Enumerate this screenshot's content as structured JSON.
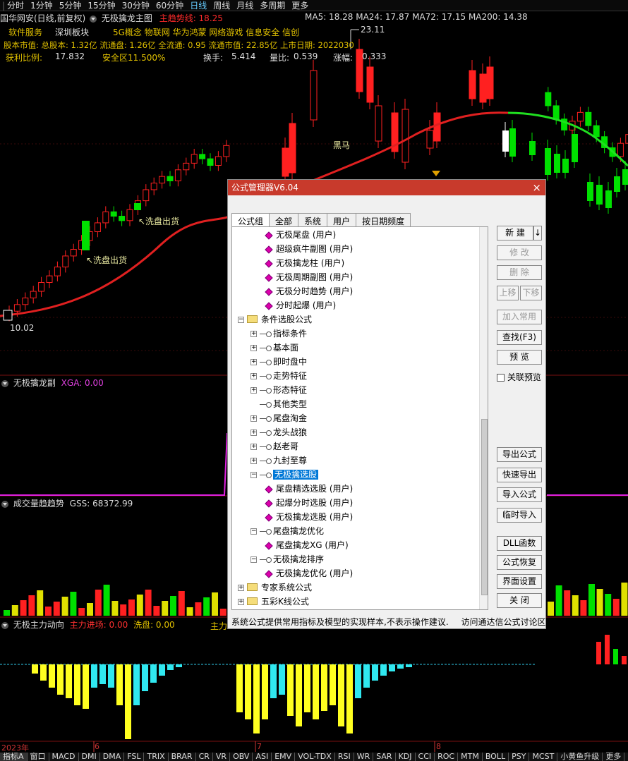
{
  "topbar": {
    "items": [
      "分时",
      "1分钟",
      "5分钟",
      "15分钟",
      "30分钟",
      "60分钟",
      "日线",
      "周线",
      "月线",
      "多周期",
      "更多"
    ],
    "active": "日线"
  },
  "main_panel": {
    "stock": "国华网安(日线,前复权)",
    "indicator_name": "无极擒龙主图",
    "trend_label": "主趋势线: 18.25",
    "ma": "MA5: 18.28  MA24: 17.87  MA72: 17.15  MA200: 14.38",
    "tags": [
      "软件服务",
      "深圳板块",
      "5G概念 物联网 华为鸿蒙 网络游戏 信息安全 信创"
    ],
    "info_line": "股本市值: 总股本: 1.32亿 流通盘: 1.26亿 全流通: 0.95 流通市值: 22.85亿 上市日期: 2022030",
    "stats": {
      "profit_label": "获利比例:",
      "profit_value": "17.832",
      "safety": "安全区11.500%",
      "turnover_label": "换手:",
      "turnover_value": "5.414",
      "vol_ratio_label": "量比:",
      "vol_ratio_value": "0.539",
      "change_label": "涨幅:",
      "change_value": "0.333"
    },
    "annotations": {
      "high": "23.11",
      "low": "10.02",
      "wash1": "↖洗盘出货",
      "wash2": "↖洗盘出货",
      "black_horse": "黑马"
    }
  },
  "sub1": {
    "name": "无极擒龙副",
    "value": "XGA: 0.00"
  },
  "sub2": {
    "name": "成交量趋趋势",
    "value": "GSS: 68372.99"
  },
  "sub3": {
    "name": "无极主力动向",
    "v1": "主力进场: 0.00",
    "v2": "洗盘: 0.00",
    "cut": "主力"
  },
  "date_axis": [
    "2023年",
    "6",
    "7",
    "8"
  ],
  "bottom_tabs": [
    "指标A",
    "窗口",
    "MACD",
    "DMI",
    "DMA",
    "FSL",
    "TRIX",
    "BRAR",
    "CR",
    "VR",
    "OBV",
    "ASI",
    "EMV",
    "VOL-TDX",
    "RSI",
    "WR",
    "SAR",
    "KDJ",
    "CCI",
    "ROC",
    "MTM",
    "BOLL",
    "PSY",
    "MCST",
    "小黄鱼升级",
    "更多"
  ],
  "dialog": {
    "title": "公式管理器V6.04",
    "close": "×",
    "tabs": [
      "公式组",
      "全部",
      "系统",
      "用户",
      "按日期频度"
    ],
    "tree": [
      {
        "level": 2,
        "icon": "formula",
        "text": "无极尾盘  (用户)"
      },
      {
        "level": 2,
        "icon": "formula",
        "text": "超级疯牛副图  (用户)"
      },
      {
        "level": 2,
        "icon": "formula",
        "text": "无极擒龙柱  (用户)"
      },
      {
        "level": 2,
        "icon": "formula",
        "text": "无极周期副图  (用户)"
      },
      {
        "level": 2,
        "icon": "formula",
        "text": "无极分时趋势  (用户)"
      },
      {
        "level": 2,
        "icon": "formula",
        "text": "分时起爆  (用户)"
      },
      {
        "level": 0,
        "icon": "folder",
        "expander": "−",
        "text": "条件选股公式"
      },
      {
        "level": 1,
        "icon": "key",
        "expander": "+",
        "text": "指标条件"
      },
      {
        "level": 1,
        "icon": "key",
        "expander": "+",
        "text": "基本面"
      },
      {
        "level": 1,
        "icon": "key",
        "expander": "+",
        "text": "即时盘中"
      },
      {
        "level": 1,
        "icon": "key",
        "expander": "+",
        "text": "走势特征"
      },
      {
        "level": 1,
        "icon": "key",
        "expander": "+",
        "text": "形态特征"
      },
      {
        "level": 1,
        "icon": "key",
        "expander": "",
        "text": "其他类型"
      },
      {
        "level": 1,
        "icon": "key",
        "expander": "+",
        "text": "尾盘淘金"
      },
      {
        "level": 1,
        "icon": "key",
        "expander": "+",
        "text": "龙头战狼"
      },
      {
        "level": 1,
        "icon": "key",
        "expander": "+",
        "text": "赵老哥"
      },
      {
        "level": 1,
        "icon": "key",
        "expander": "+",
        "text": "九封至尊"
      },
      {
        "level": 1,
        "icon": "key",
        "expander": "−",
        "text": "无极擒选股",
        "selected": true
      },
      {
        "level": 2,
        "icon": "formula",
        "text": "尾盘精选选股  (用户)"
      },
      {
        "level": 2,
        "icon": "formula",
        "text": "起爆分时选股  (用户)"
      },
      {
        "level": 2,
        "icon": "formula",
        "text": "无极擒龙选股  (用户)"
      },
      {
        "level": 1,
        "icon": "key",
        "expander": "−",
        "text": "尾盘擒龙优化"
      },
      {
        "level": 2,
        "icon": "formula",
        "text": "尾盘擒龙XG  (用户)"
      },
      {
        "level": 1,
        "icon": "key",
        "expander": "−",
        "text": "无极擒龙排序"
      },
      {
        "level": 2,
        "icon": "formula",
        "text": "无极擒龙优化  (用户)"
      },
      {
        "level": 0,
        "icon": "folder",
        "expander": "+",
        "text": "专家系统公式"
      },
      {
        "level": 0,
        "icon": "folder",
        "expander": "+",
        "text": "五彩K线公式"
      }
    ],
    "buttons": {
      "new": "新 建",
      "new_arrow": "↓",
      "modify": "修 改",
      "delete": "删 除",
      "up": "上移",
      "down": "下移",
      "add_common": "加入常用",
      "find": "查找(F3)",
      "preview": "预 览",
      "export": "导出公式",
      "quick_export": "快速导出",
      "import": "导入公式",
      "temp_import": "临时导入",
      "dll": "DLL函数",
      "restore": "公式恢复",
      "ui_settings": "界面设置",
      "close": "关 闭"
    },
    "link_preview": "关联预览",
    "footer": [
      "系统公式提供常用指标及模型的实现样本,不表示操作建议.",
      "访问通达信公式讨论区"
    ]
  },
  "colors": {
    "up": "#ff2020",
    "down": "#00e000",
    "accent": "#c83a2c"
  }
}
